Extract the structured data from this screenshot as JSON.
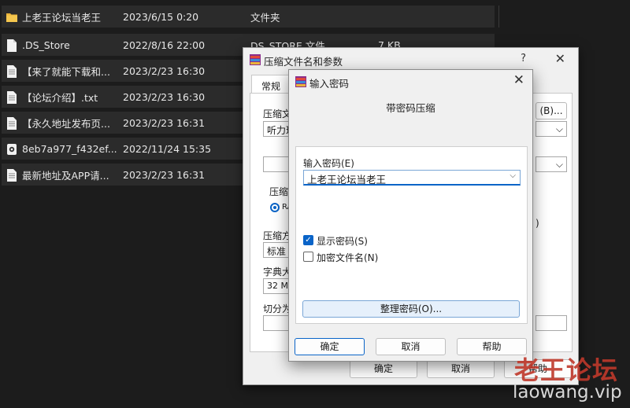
{
  "files": [
    {
      "name": "上老王论坛当老王",
      "date": "2023/6/15 0:20",
      "type": "文件夹",
      "size": "",
      "icon": "folder-icon"
    },
    {
      "name": ".DS_Store",
      "date": "2022/8/16 22:00",
      "type": "DS_STORE 文件",
      "size": "7 KB",
      "icon": "file-icon"
    },
    {
      "name": "【来了就能下载和...",
      "date": "2023/2/23 16:30",
      "type": "",
      "size": "",
      "icon": "text-file-icon"
    },
    {
      "name": "【论坛介绍】.txt",
      "date": "2023/2/23 16:30",
      "type": "",
      "size": "",
      "icon": "text-file-icon"
    },
    {
      "name": "【永久地址发布页...",
      "date": "2023/2/23 16:31",
      "type": "",
      "size": "",
      "icon": "text-file-icon"
    },
    {
      "name": "8eb7a977_f432ef...",
      "date": "2022/11/24 15:35",
      "type": "",
      "size": "",
      "icon": "image-file-icon"
    },
    {
      "name": "最新地址及APP请...",
      "date": "2023/2/23 16:31",
      "type": "",
      "size": "",
      "icon": "text-file-icon"
    }
  ],
  "back_dialog": {
    "title": "压缩文件名和参数",
    "help": "?",
    "close": "✕",
    "tab": "常规",
    "archive_name_label": "压缩文",
    "browse_label": "(B)...",
    "archive_name_value": "听力理",
    "format_label": "压缩",
    "format_option": "RA",
    "method_label": "压缩方",
    "method_value": "标准",
    "dict_label": "字典大",
    "dict_value": "32 MB",
    "split_label": "切分为",
    "paren": ")",
    "ok": "确定",
    "cancel": "取消",
    "help_btn": "帮助"
  },
  "password_dialog": {
    "title": "输入密码",
    "close": "✕",
    "header": "带密码压缩",
    "password_label": "输入密码(E)",
    "password_value": "上老王论坛当老王",
    "show_password": "显示密码(S)",
    "show_password_checked": true,
    "encrypt_filenames": "加密文件名(N)",
    "encrypt_filenames_checked": false,
    "organize_button": "整理密码(O)...",
    "ok": "确定",
    "cancel": "取消",
    "help": "帮助"
  },
  "watermark": {
    "title": "老王论坛",
    "url": "laowang.vip"
  },
  "colors": {
    "background": "#1c1c1c",
    "row": "#2b2b2b",
    "accent": "#0a64c8",
    "watermark": "#c0392b"
  }
}
